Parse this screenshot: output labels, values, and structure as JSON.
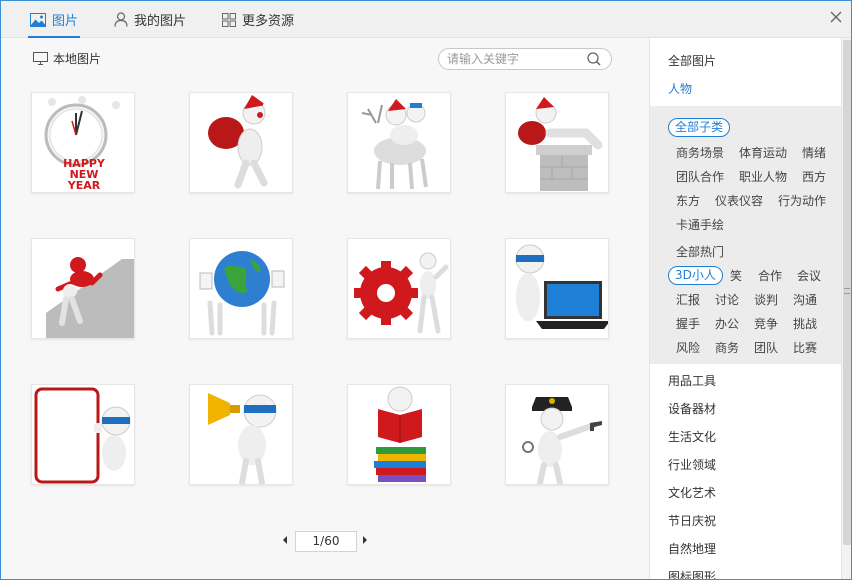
{
  "tabs": [
    {
      "label": "图片",
      "icon": "picture-icon",
      "active": true
    },
    {
      "label": "我的图片",
      "icon": "user-icon",
      "active": false
    },
    {
      "label": "更多资源",
      "icon": "grid-icon",
      "active": false
    }
  ],
  "toolbar": {
    "local_label": "本地图片",
    "search_placeholder": "请输入关键字"
  },
  "thumbnails": [
    {
      "name": "thumb-clock-happy-new-year",
      "caption_lines": [
        "HAPPY",
        "NEW",
        "YEAR"
      ]
    },
    {
      "name": "thumb-santa-with-sack"
    },
    {
      "name": "thumb-santa-on-reindeer"
    },
    {
      "name": "thumb-santa-in-chimney"
    },
    {
      "name": "thumb-climbing-red-figure"
    },
    {
      "name": "thumb-globe-figures"
    },
    {
      "name": "thumb-red-gear-figure"
    },
    {
      "name": "thumb-figure-with-laptop"
    },
    {
      "name": "thumb-figure-behind-board"
    },
    {
      "name": "thumb-figure-megaphone"
    },
    {
      "name": "thumb-figure-on-books"
    },
    {
      "name": "thumb-police-figure"
    }
  ],
  "pagination": {
    "current": "1/60"
  },
  "sidebar": {
    "all_images": "全部图片",
    "active_category": "人物",
    "groups": [
      {
        "selected": "全部子类",
        "tags": [
          "商务场景",
          "体育运动",
          "情绪",
          "团队合作",
          "职业人物",
          "西方",
          "东方",
          "仪表仪容",
          "行为动作",
          "卡通手绘"
        ]
      },
      {
        "title": "全部热门",
        "selected": "3D小人",
        "tags": [
          "笑",
          "合作",
          "会议",
          "汇报",
          "讨论",
          "谈判",
          "沟通",
          "握手",
          "办公",
          "竞争",
          "挑战",
          "风险",
          "商务",
          "团队",
          "比赛"
        ]
      }
    ],
    "categories": [
      "用品工具",
      "设备器材",
      "生活文化",
      "行业领域",
      "文化艺术",
      "节日庆祝",
      "自然地理",
      "图标图形"
    ]
  },
  "colors": {
    "accent": "#1e7fd7",
    "red": "#d0191c"
  }
}
